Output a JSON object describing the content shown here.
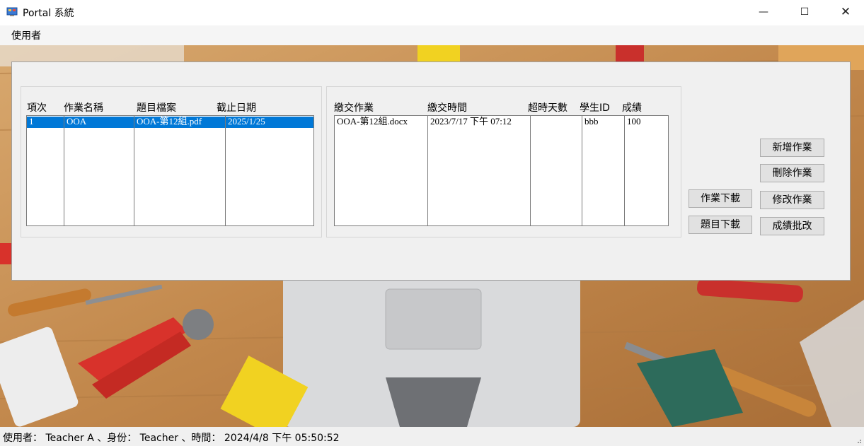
{
  "window": {
    "title": "Portal 系統",
    "minimize_glyph": "—",
    "maximize_glyph": "☐",
    "close_glyph": "✕"
  },
  "menu": {
    "items": [
      {
        "label": "使用者"
      }
    ]
  },
  "assignments": {
    "headers": [
      "項次",
      "作業名稱",
      "題目檔案",
      "截止日期"
    ],
    "rows": [
      {
        "no": "1",
        "name": "OOA",
        "file": "OOA-第12組.pdf",
        "due": "2025/1/25",
        "selected": true
      }
    ]
  },
  "submissions": {
    "headers": [
      "繳交作業",
      "繳交時間",
      "超時天數",
      "學生ID",
      "成績"
    ],
    "rows": [
      {
        "file": "OOA-第12組.docx",
        "time": "2023/7/17 下午 07:12",
        "overdue": "",
        "student_id": "bbb",
        "score": "100"
      }
    ]
  },
  "buttons": {
    "add": "新增作業",
    "delete": "刪除作業",
    "download_hw": "作業下載",
    "edit": "修改作業",
    "download_q": "題目下載",
    "grade": "成績批改"
  },
  "status": {
    "text": "使用者： Teacher A 、身份： Teacher 、時間： 2024/4/8 下午 05:50:52"
  },
  "colors": {
    "selection": "#0078d7",
    "window_bg": "#f0f0f0"
  }
}
